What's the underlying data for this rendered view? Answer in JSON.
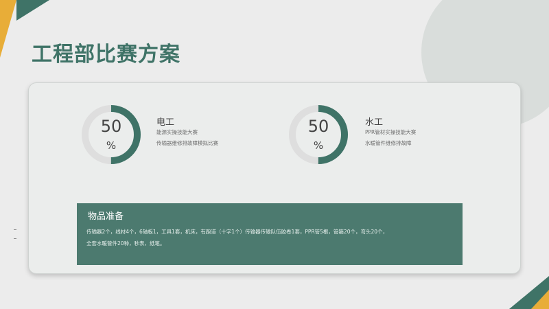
{
  "slide": {
    "title": "工程部比赛方案"
  },
  "items": [
    {
      "percent": "50",
      "unit": "%",
      "title": "电工",
      "line1": "能源实操技能大赛",
      "line2": "传输器维修排故障模拟比赛",
      "ring_value_fraction": 0.5
    },
    {
      "percent": "50",
      "unit": "%",
      "title": "水工",
      "line1": "PPR管材实操技能大赛",
      "line2": "水暖管件维修排故障",
      "ring_value_fraction": 0.5
    }
  ],
  "supply": {
    "title": "物品准备",
    "line1": "传输器2个，线材4个，6轴板1，工具1套，机床，有跑道（十字1个）传输器传输队伍胶卷1套，PPR管5根，管箍20个，弯头20个，",
    "line2": "全套水暖管件20种，秒表，纸笔。"
  },
  "colors": {
    "accent_green": "#3f7367",
    "ring_track": "#dedede",
    "supply_bg": "#4c7a6f",
    "corner_orange": "#e8ad38",
    "corner_green": "#3f7367",
    "gray_circle": "#d9dddb"
  }
}
